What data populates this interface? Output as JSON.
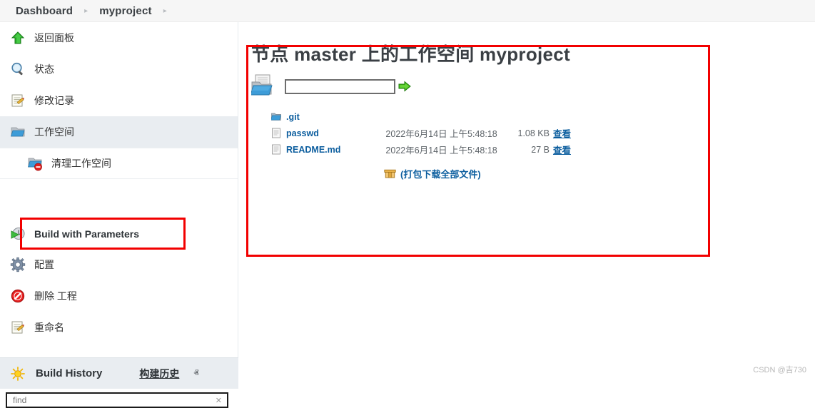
{
  "breadcrumb": {
    "dashboard": "Dashboard",
    "project": "myproject",
    "separator": "▸"
  },
  "sidebar": {
    "items": [
      {
        "label": "返回面板",
        "icon": "up-arrow-icon"
      },
      {
        "label": "状态",
        "icon": "magnifier-icon"
      },
      {
        "label": "修改记录",
        "icon": "notepad-pencil-icon"
      },
      {
        "label": "工作空间",
        "icon": "folder-icon"
      }
    ],
    "sub_item": {
      "label": "清理工作空间",
      "icon": "folder-delete-icon"
    },
    "build_params": {
      "label": "Build with Parameters",
      "icon": "clock-play-icon"
    },
    "items_after": [
      {
        "label": "配置",
        "icon": "gear-icon"
      },
      {
        "label": "删除 工程",
        "icon": "no-entry-icon"
      },
      {
        "label": "重命名",
        "icon": "notepad-pencil-icon"
      }
    ],
    "build_history": {
      "title": "Build History",
      "link": "构建历史",
      "chevron": "ⱏ",
      "icon": "sun-icon",
      "search_placeholder": "find",
      "search_value": "",
      "clear": "✕"
    }
  },
  "main": {
    "title": "节点 master 上的工作空间 myproject",
    "path_input_value": "",
    "path_input_placeholder": "",
    "go_icon": "green-arrow-icon",
    "folder_icon": "workspace-folder-icon",
    "files": [
      {
        "icon": "folder-icon",
        "name": ".git",
        "date": "",
        "size": "",
        "view": ""
      },
      {
        "icon": "file-icon",
        "name": "passwd",
        "date": "2022年6月14日 上午5:48:18",
        "size": "1.08 KB",
        "view": "查看"
      },
      {
        "icon": "file-icon",
        "name": "README.md",
        "date": "2022年6月14日 上午5:48:18",
        "size": "27 B",
        "view": "查看"
      }
    ],
    "download_all": "(打包下载全部文件)",
    "download_icon": "archive-box-icon"
  },
  "watermark": "CSDN @吉730",
  "colors": {
    "annotation_red": "#f20000",
    "link_blue": "#0b5d9e",
    "active_row": "#e9edf1",
    "header_bg": "#f6f6f6"
  }
}
